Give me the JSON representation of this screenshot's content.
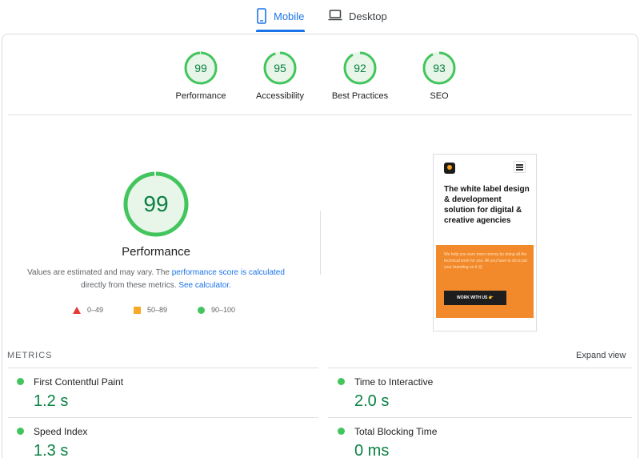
{
  "tabs": [
    {
      "label": "Mobile",
      "active": true
    },
    {
      "label": "Desktop",
      "active": false
    }
  ],
  "scores": [
    {
      "label": "Performance",
      "value": "99",
      "fraction": 0.99
    },
    {
      "label": "Accessibility",
      "value": "95",
      "fraction": 0.95
    },
    {
      "label": "Best Practices",
      "value": "92",
      "fraction": 0.92
    },
    {
      "label": "SEO",
      "value": "93",
      "fraction": 0.93
    }
  ],
  "performance": {
    "score": "99",
    "fraction": 0.99,
    "title": "Performance",
    "desc_part1": "Values are estimated and may vary. The ",
    "desc_link1": "performance score is calculated",
    "desc_part2": "directly from these metrics. ",
    "desc_link2": "See calculator."
  },
  "legend": {
    "fail": "0–49",
    "average": "50–89",
    "pass": "90–100"
  },
  "screenshot": {
    "headline": "The white label design & development solution for digital & creative agencies",
    "body": "We help you earn more money by doing all the technical work for you. All you have to do is put your branding on it 😊",
    "cta": "WORK WITH US 👉"
  },
  "metrics": {
    "title": "METRICS",
    "expand_label": "Expand view",
    "items": [
      {
        "name": "First Contentful Paint",
        "value": "1.2 s"
      },
      {
        "name": "Time to Interactive",
        "value": "2.0 s"
      },
      {
        "name": "Speed Index",
        "value": "1.3 s"
      },
      {
        "name": "Total Blocking Time",
        "value": "0 ms"
      }
    ]
  },
  "colors": {
    "pass_green": "#0b8043",
    "gauge_green": "#43c55d",
    "gauge_fill": "#e8f5e9",
    "tab_blue": "#1a73e8",
    "fail_red": "#e53935",
    "average_orange": "#f9a825"
  }
}
